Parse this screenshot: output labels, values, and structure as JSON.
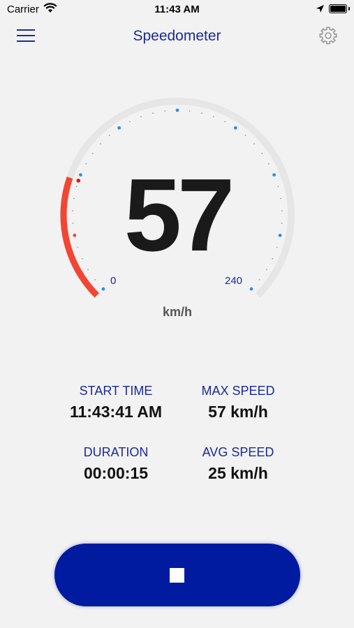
{
  "status_bar": {
    "carrier": "Carrier",
    "time": "11:43 AM"
  },
  "nav": {
    "title": "Speedometer",
    "menu_icon": "hamburger-menu-icon",
    "settings_icon": "gear-icon"
  },
  "gauge": {
    "speed": "57",
    "unit": "km/h",
    "min_label": "0",
    "max_label": "240",
    "speed_value": 57,
    "max_value": 240,
    "track_color": "#e6e6e6",
    "progress_color": "#f24632",
    "tick_color": "#2f8fdd"
  },
  "stats": {
    "start_time": {
      "label": "START TIME",
      "value": "11:43:41 AM"
    },
    "max_speed": {
      "label": "MAX SPEED",
      "value": "57 km/h"
    },
    "duration": {
      "label": "DURATION",
      "value": "00:00:15"
    },
    "avg_speed": {
      "label": "AVG SPEED",
      "value": "25 km/h"
    }
  },
  "stop_button": {
    "icon": "stop-icon",
    "color": "#001aa0"
  }
}
